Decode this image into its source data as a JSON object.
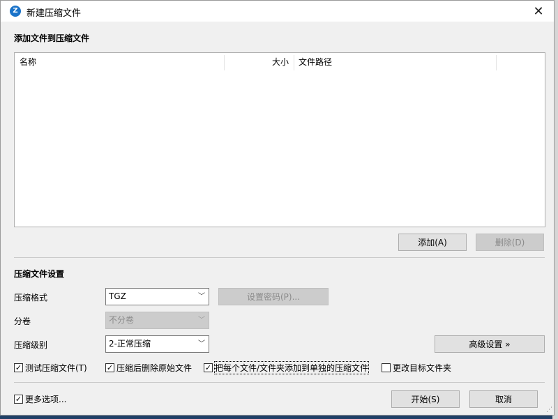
{
  "window": {
    "title": "新建压缩文件",
    "close_glyph": "✕"
  },
  "files": {
    "heading": "添加文件到压缩文件",
    "columns": [
      "名称",
      "大小",
      "文件路径"
    ],
    "add_button": "添加(A)",
    "delete_button": "删除(D)"
  },
  "settings": {
    "heading": "压缩文件设置",
    "format_label": "压缩格式",
    "format_value": "TGZ",
    "password_button": "设置密码(P)...",
    "split_label": "分卷",
    "split_value": "不分卷",
    "level_label": "压缩级别",
    "level_value": "2-正常压缩",
    "advanced_button": "高级设置 »"
  },
  "options": {
    "test_archive": {
      "label": "测试压缩文件(T)",
      "checked": true
    },
    "delete_original": {
      "label": "压缩后删除原始文件",
      "checked": true
    },
    "separate_archives": {
      "label": "把每个文件/文件夹添加到单独的压缩文件",
      "checked": true
    },
    "change_target": {
      "label": "更改目标文件夹",
      "checked": false
    },
    "more_options": {
      "label": "更多选项...",
      "checked": true
    }
  },
  "footer": {
    "start_button": "开始(S)",
    "cancel_button": "取消"
  }
}
